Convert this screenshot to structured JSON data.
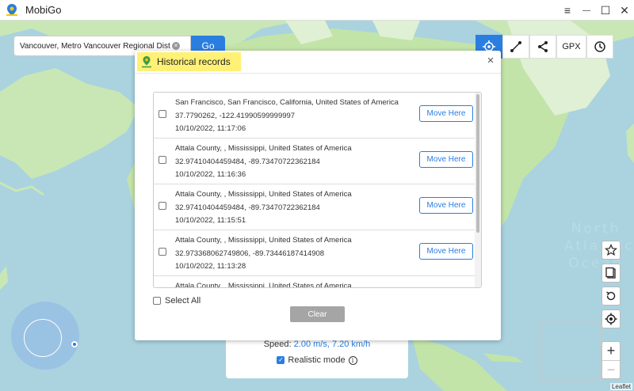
{
  "app": {
    "title": "MobiGo"
  },
  "window_controls": {
    "menu_icon": "≡",
    "minimize_icon": "—",
    "maximize_icon": "☐",
    "close_icon": "✕"
  },
  "search": {
    "value": "Vancouver, Metro Vancouver Regional District,",
    "clear_icon": "×",
    "go_label": "Go"
  },
  "toolbar": {
    "gpx_label": "GPX"
  },
  "map": {
    "ocean_label": "North Atlantic Ocean",
    "attribution": "Leaflet"
  },
  "speed": {
    "prefix": "Speed:",
    "value": "2.00 m/s, 7.20 km/h",
    "realistic_label": "Realistic mode",
    "realistic_checked": true,
    "info_icon": "i"
  },
  "zoom": {
    "in": "+",
    "out": "−"
  },
  "modal": {
    "title": "Historical records",
    "close_icon": "×",
    "move_label": "Move Here",
    "records": [
      {
        "address": "San Francisco, San Francisco, California, United States of America",
        "coords": "37.7790262, -122.41990599999997",
        "time": "10/10/2022, 11:17:06"
      },
      {
        "address": "Attala County, , Mississippi, United States of America",
        "coords": "32.97410404459484, -89.73470722362184",
        "time": "10/10/2022, 11:16:36"
      },
      {
        "address": "Attala County, , Mississippi, United States of America",
        "coords": "32.97410404459484, -89.73470722362184",
        "time": "10/10/2022, 11:15:51"
      },
      {
        "address": "Attala County, , Mississippi, United States of America",
        "coords": "32.973368062749806, -89.73446187414908",
        "time": "10/10/2022, 11:13:28"
      },
      {
        "address": "Attala County, , Mississippi, United States of America",
        "coords": "",
        "time": ""
      }
    ],
    "select_all_label": "Select All",
    "clear_label": "Clear"
  }
}
